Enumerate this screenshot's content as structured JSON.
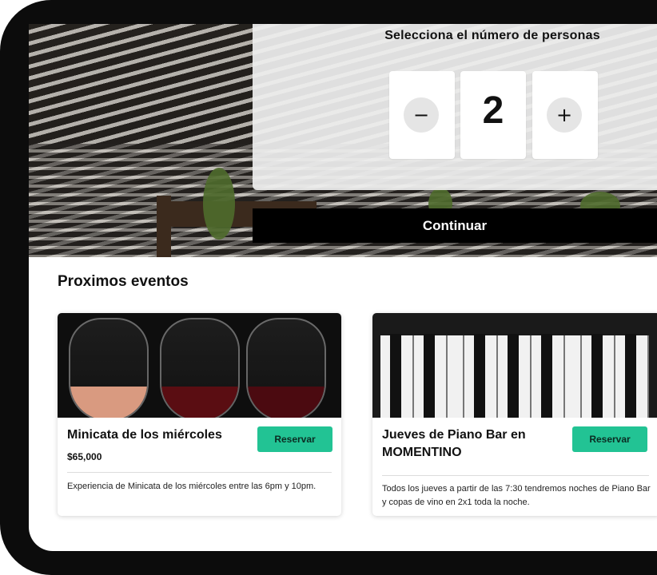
{
  "booking": {
    "title": "Selecciona el número de personas",
    "minus_label": "−",
    "count": "2",
    "plus_label": "+",
    "continue_label": "Continuar"
  },
  "events": {
    "heading": "Proximos eventos",
    "cards": [
      {
        "title": "Minicata de los miércoles",
        "price": "$65,000",
        "button_label": "Reservar",
        "description": "Experiencia de Minicata de los miércoles entre las 6pm y 10pm."
      },
      {
        "title": "Jueves de Piano Bar en MOMENTINO",
        "button_label": "Reservar",
        "description": "Todos los jueves a partir de las 7:30 tendremos noches de Piano Bar y copas de vino en 2x1 toda la noche."
      }
    ]
  },
  "colors": {
    "accent": "#22c394",
    "continue_bg": "#000000",
    "bezel": "#0c0c0c"
  }
}
